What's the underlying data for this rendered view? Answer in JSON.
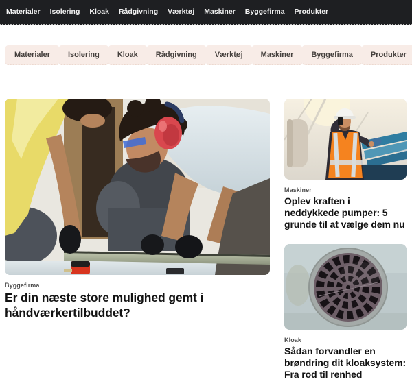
{
  "nav": {
    "items": [
      "Materialer",
      "Isolering",
      "Kloak",
      "Rådgivning",
      "Værktøj",
      "Maskiner",
      "Byggefirma",
      "Produkter"
    ]
  },
  "chipbar": {
    "items": [
      "Materialer",
      "Isolering",
      "Kloak",
      "Rådgivning",
      "Værktøj",
      "Maskiner",
      "Byggefirma",
      "Produkter"
    ]
  },
  "articles": {
    "main": {
      "category": "Byggefirma",
      "title": "Er din næste store mulighed gemt i håndværkertilbuddet?",
      "image": "photo-two-workers-measuring-metal-profile"
    },
    "side": [
      {
        "category": "Maskiner",
        "title": "Oplev kraften i neddykkede pumper: 5 grunde til at vælge dem nu",
        "image": "photo-worker-orange-vest-on-phone-rooftop"
      },
      {
        "category": "Kloak",
        "title": "Sådan forvandler en brøndring dit kloaksystem: Fra rod til renhed",
        "image": "photo-round-sewer-drain-grate"
      }
    ]
  },
  "colors": {
    "nav_bg": "#1e1f22",
    "nav_text": "#f2f2f2",
    "chip_bg": "#f8ece7",
    "chip_text": "#45403d",
    "category_text": "#4e4e4e",
    "title_text": "#131313",
    "divider": "#e3e3e3"
  }
}
